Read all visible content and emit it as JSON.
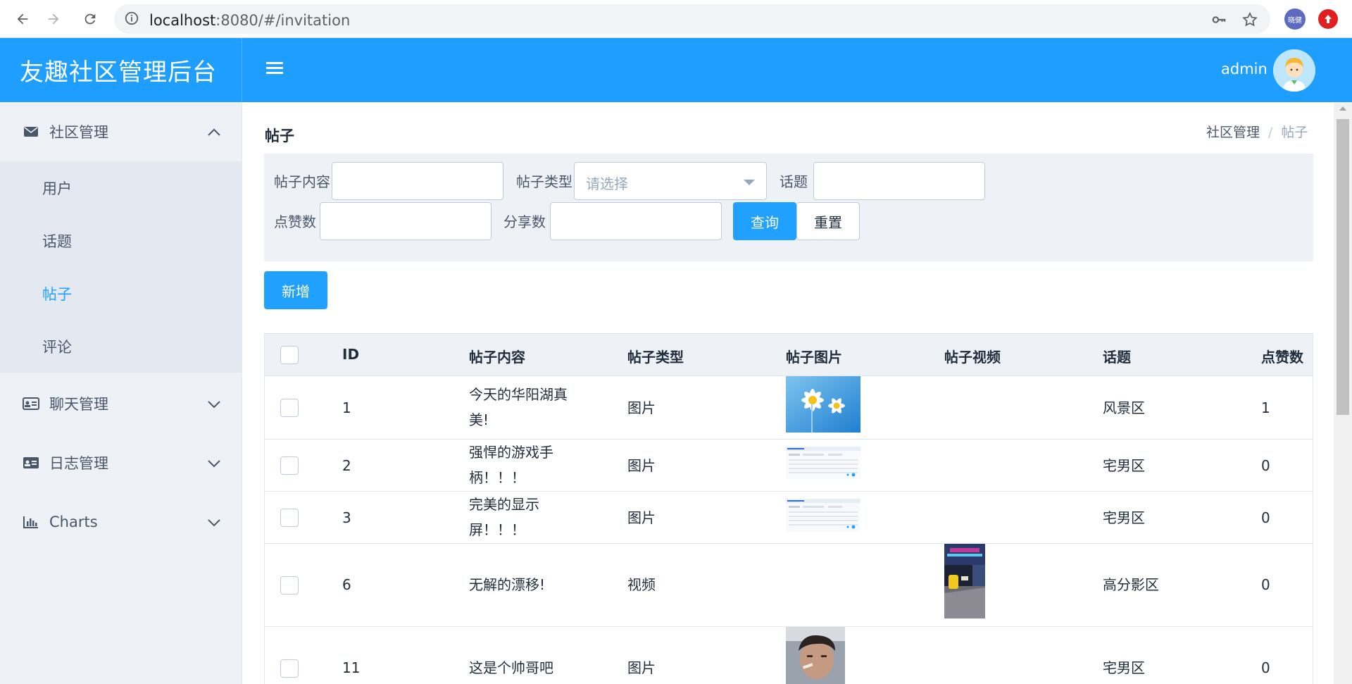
{
  "browser": {
    "url_host": "localhost",
    "url_rest": ":8080/#/invitation",
    "profile_label": "晓健"
  },
  "app": {
    "title": "友趣社区管理后台",
    "user": "admin"
  },
  "sidebar": {
    "groups": [
      {
        "label": "社区管理",
        "icon": "envelope-icon",
        "expanded": true,
        "items": [
          {
            "label": "用户",
            "active": false
          },
          {
            "label": "话题",
            "active": false
          },
          {
            "label": "帖子",
            "active": true
          },
          {
            "label": "评论",
            "active": false
          }
        ]
      },
      {
        "label": "聊天管理",
        "icon": "id-card-icon",
        "expanded": false
      },
      {
        "label": "日志管理",
        "icon": "address-card-icon",
        "expanded": false
      },
      {
        "label": "Charts",
        "icon": "bar-chart-icon",
        "expanded": false
      }
    ]
  },
  "page": {
    "title": "帖子",
    "breadcrumb": [
      "社区管理",
      "/",
      "帖子"
    ]
  },
  "search": {
    "content_label": "帖子内容",
    "content_value": "",
    "type_label": "帖子类型",
    "type_placeholder": "请选择",
    "topic_label": "话题",
    "topic_value": "",
    "likes_label": "点赞数",
    "likes_value": "",
    "shares_label": "分享数",
    "shares_value": "",
    "query_button": "查询",
    "reset_button": "重置"
  },
  "add_button": "新增",
  "table": {
    "columns": [
      "ID",
      "帖子内容",
      "帖子类型",
      "帖子图片",
      "帖子视频",
      "话题",
      "点赞数"
    ],
    "rows": [
      {
        "id": "1",
        "content_l1": "今天的华阳湖真",
        "content_l2": "美!",
        "type": "图片",
        "image": "daisy-wallpaper",
        "video": "",
        "topic": "风景区",
        "likes": "1"
      },
      {
        "id": "2",
        "content_l1": "强悍的游戏手",
        "content_l2": "柄！！！",
        "type": "图片",
        "image": "admin-screenshot",
        "video": "",
        "topic": "宅男区",
        "likes": "0"
      },
      {
        "id": "3",
        "content_l1": "完美的显示",
        "content_l2": "屏！！！",
        "type": "图片",
        "image": "admin-screenshot",
        "video": "",
        "topic": "宅男区",
        "likes": "0"
      },
      {
        "id": "6",
        "content_l1": "无解的漂移!",
        "content_l2": "",
        "type": "视频",
        "image": "",
        "video": "racing-street-night",
        "topic": "高分影区",
        "likes": "0"
      },
      {
        "id": "11",
        "content_l1": "这是个帅哥吧",
        "content_l2": "",
        "type": "图片",
        "image": "selfie-photo",
        "video": "",
        "topic": "宅男区",
        "likes": "0"
      }
    ]
  },
  "colors": {
    "brand": "#1e9fff",
    "primary": "#20a0ff",
    "sidebar_bg": "#eef1f6"
  }
}
